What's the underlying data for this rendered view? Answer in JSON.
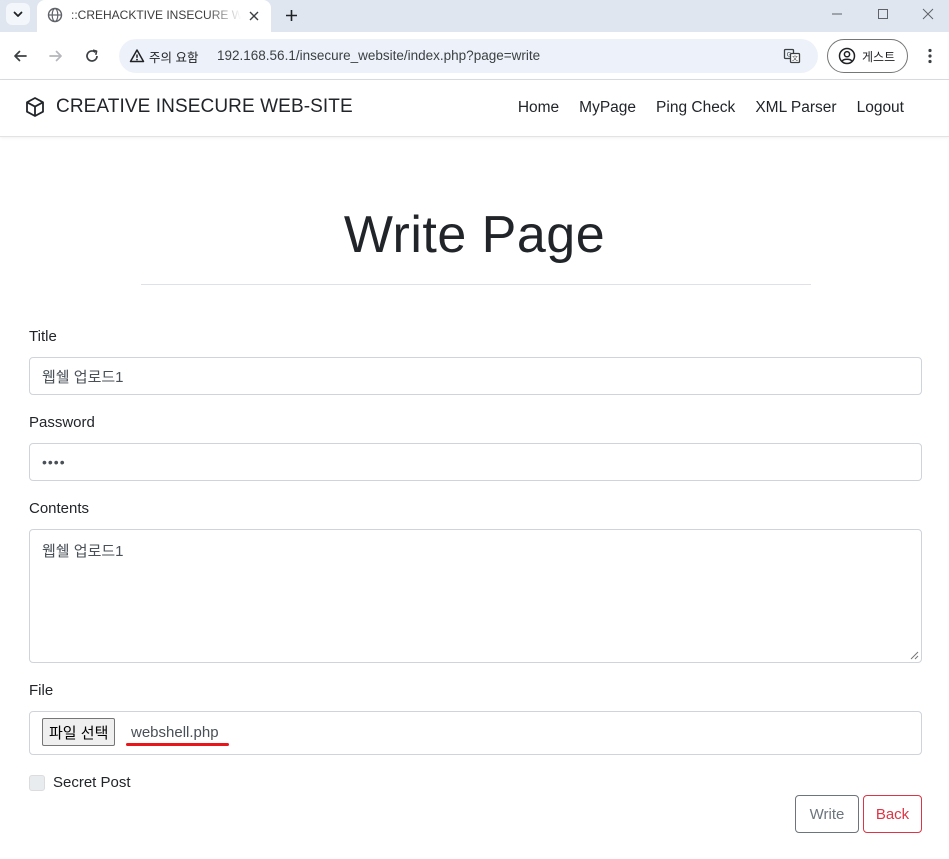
{
  "browser": {
    "tab_title": "::CREHACKTIVE INSECURE WEB-SITE::",
    "security_label": "주의 요함",
    "url": "192.168.56.1/insecure_website/index.php?page=write",
    "profile_label": "게스트"
  },
  "site": {
    "brand": "CREATIVE INSECURE WEB-SITE",
    "nav": [
      "Home",
      "MyPage",
      "Ping Check",
      "XML Parser",
      "Logout"
    ]
  },
  "page": {
    "heading": "Write Page"
  },
  "form": {
    "title_label": "Title",
    "title_value": "웹쉘 업로드1",
    "password_label": "Password",
    "password_value": "••••",
    "contents_label": "Contents",
    "contents_value": "웹쉘 업로드1",
    "file_label": "File",
    "file_button": "파일 선택",
    "file_name": "webshell.php",
    "secret_label": "Secret Post",
    "secret_checked": false,
    "write_button": "Write",
    "back_button": "Back"
  },
  "colors": {
    "annotation_underline": "#e8151b",
    "back_button": "#dc3545",
    "write_button": "#6c757d"
  },
  "icons": [
    "tab-search-icon",
    "globe-favicon-icon",
    "close-icon",
    "plus-icon",
    "minimize-icon",
    "maximize-icon",
    "back-arrow-icon",
    "forward-arrow-icon",
    "reload-icon",
    "warning-icon",
    "translate-icon",
    "profile-icon",
    "kebab-menu-icon",
    "cube-logo-icon"
  ]
}
